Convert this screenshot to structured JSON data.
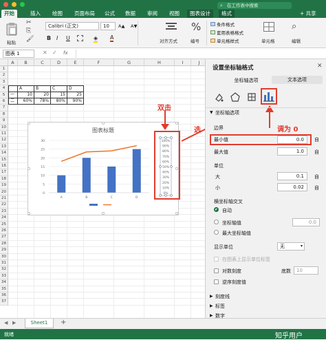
{
  "ribbon": {
    "tabs": [
      "开始",
      "插入",
      "绘图",
      "页面布局",
      "公式",
      "数据",
      "审阅",
      "视图",
      "图表设计",
      "格式"
    ],
    "search_placeholder": "在工作表中搜索",
    "share_label": "+ 共享",
    "paste_label": "粘贴",
    "font_name": "Calibri (正文)",
    "font_size": "10",
    "font_grow": "A▲",
    "font_shrink": "A▼",
    "bold": "B",
    "italic": "I",
    "underline": "U",
    "align_label": "对齐方式",
    "number_label": "编号",
    "number_symbol": "%",
    "cond_format": "条件格式",
    "table_format": "套用表格格式",
    "cell_style": "单元格样式",
    "cells_label": "单元格",
    "edit_label": "编辑"
  },
  "formula_bar": {
    "name_box": "图表 1",
    "fx": "fx"
  },
  "grid": {
    "columns": [
      "A",
      "B",
      "C",
      "D",
      "E",
      "F",
      "G",
      "H",
      "I",
      "J"
    ],
    "rows": [
      "1",
      "2",
      "3",
      "4",
      "5",
      "6",
      "7",
      "8",
      "9",
      "10",
      "11",
      "12",
      "13",
      "14",
      "15",
      "16",
      "17",
      "18",
      "19",
      "20",
      "21",
      "22",
      "23",
      "24",
      "25",
      "26",
      "27",
      "28",
      "29",
      "30",
      "31",
      "32",
      "33",
      "34",
      "35",
      "36",
      "37"
    ],
    "table": {
      "header": [
        "",
        "A",
        "B",
        "C",
        "D"
      ],
      "rows": [
        [
          "一",
          "10",
          "20",
          "15",
          "25"
        ],
        [
          "二",
          "60%",
          "78%",
          "80%",
          "90%"
        ]
      ]
    }
  },
  "chart": {
    "title": "图表标题",
    "left_axis_ticks": [
      "30",
      "25",
      "20",
      "15",
      "10",
      "5",
      "0"
    ],
    "right_axis_ticks": [
      "100%",
      "90%",
      "80%",
      "70%",
      "60%",
      "50%",
      "40%",
      "30%",
      "20%",
      "10%",
      "0%"
    ],
    "legend_items": [
      "",
      ""
    ]
  },
  "chart_data": {
    "type": "bar",
    "title": "图表标题",
    "categories": [
      "A",
      "B",
      "C",
      "D"
    ],
    "series": [
      {
        "name": "一",
        "type": "bar",
        "axis": "left",
        "values": [
          10,
          20,
          15,
          25
        ],
        "color": "#4472c4"
      },
      {
        "name": "二",
        "type": "line",
        "axis": "right",
        "values": [
          0.6,
          0.78,
          0.8,
          0.9
        ],
        "color": "#ed7d31"
      }
    ],
    "ylim": [
      0,
      30
    ],
    "y2lim": [
      0,
      1.0
    ]
  },
  "annotations": {
    "double_click": "双击",
    "select": "选",
    "set_zero": "调为 0"
  },
  "pane": {
    "title": "设置坐标轴格式",
    "tab_axis_options": "坐标轴选项",
    "tab_text_options": "文本选项",
    "section_axis": "坐标轴选项",
    "bounds": "边界",
    "min_label": "最小值",
    "min_value": "0.0",
    "max_label": "最大值",
    "max_value": "1.0",
    "units": "单位",
    "major_label": "大",
    "major_value": "0.1",
    "minor_label": "小",
    "minor_value": "0.02",
    "cross_title": "横坐标轴交叉",
    "cross_auto": "自动",
    "cross_value": "坐标轴值",
    "cross_value_input": "0.0",
    "cross_max": "最大坐标轴值",
    "display_units": "显示单位",
    "display_units_value": "无",
    "show_units_label": "在图表上显示单位标签",
    "log_scale": "对数刻度",
    "log_base_label": "底数",
    "log_base_value": "10",
    "reverse": "逆序刻度值",
    "tick_marks": "刻度线",
    "labels": "标签",
    "number": "数字"
  },
  "sheets": {
    "active": "Sheet1",
    "add": "+"
  },
  "status": {
    "ready": "就绪",
    "watermark": "知乎用户"
  },
  "colors": {
    "excel_green": "#217346",
    "bar_blue": "#4472c4",
    "line_orange": "#ed7d31",
    "annotation_red": "#e23b2e"
  }
}
